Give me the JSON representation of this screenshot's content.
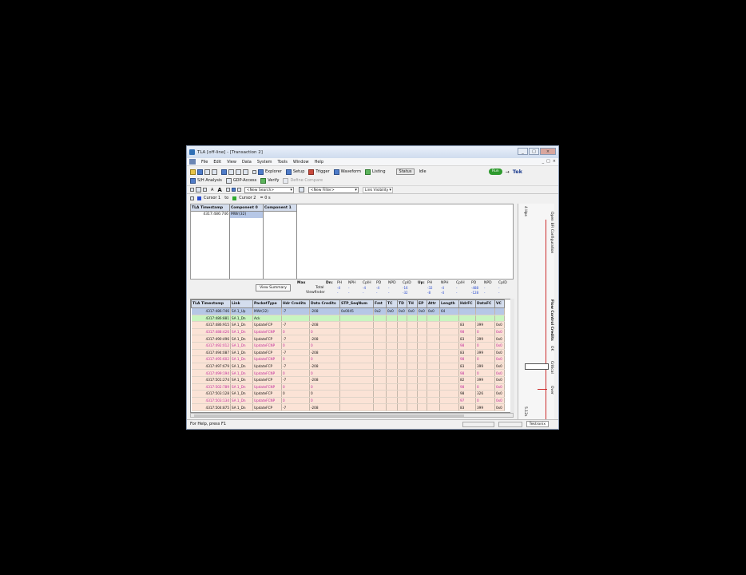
{
  "window": {
    "title": "TLA [off-line] - [Transaction 2]",
    "controls": {
      "minimize": "_",
      "maximize": "□",
      "close": "×"
    },
    "mdi_controls": [
      "_",
      "□",
      "×"
    ]
  },
  "menu": [
    "File",
    "Edit",
    "View",
    "Data",
    "System",
    "Tools",
    "Window",
    "Help"
  ],
  "toolbar1": {
    "explorer": "Explorer",
    "setup": "Setup",
    "trigger": "Trigger",
    "waveform": "Waveform",
    "listing": "Listing",
    "status": "Status",
    "state": "Idle",
    "run": "Run",
    "brand": "Tek"
  },
  "toolbar2": {
    "sh_analysis": "S/H Analysis",
    "gdp_access": "GDP-Access",
    "verify": "Verify",
    "define_compare": "Define Compare"
  },
  "toolbar3": {
    "font_a": "A",
    "font_a2": "A",
    "search_combo": "<New Search>",
    "filter_combo": "<New Filter>",
    "link_visibility": "Link Visibility"
  },
  "cursor_bar": {
    "cursor1": "Cursor 1",
    "to": "to",
    "cursor2": "Cursor 2",
    "delta": "= 0 s"
  },
  "top_table": {
    "headers": [
      "TLA Timestamp",
      "Component 0",
      "Component 1"
    ],
    "rows": [
      [
        "4317:486:746",
        "MWr(32)",
        ""
      ]
    ]
  },
  "summary": {
    "button": "View Summary",
    "max": "Max",
    "total": "Total",
    "viewfinder": "Viewfinder",
    "dn": "Dn:",
    "up": "Up:",
    "dn_cols": [
      "PH",
      "NPH",
      "CplH",
      "PD",
      "NPD",
      "CplD"
    ],
    "up_cols": [
      "PH",
      "NPH",
      "CplH",
      "PD",
      "NPD",
      "CplD"
    ],
    "dn_total": [
      "-4",
      "-",
      "-4",
      "-4",
      "-",
      "-16"
    ],
    "dn_view": [
      "-",
      "-",
      "-",
      "-",
      "-",
      "-32"
    ],
    "up_total": [
      "-32",
      "-4",
      "-",
      "-488",
      "-",
      "-"
    ],
    "up_view": [
      "-8",
      "-4",
      "-",
      "-128",
      "-",
      "-"
    ]
  },
  "main_table": {
    "headers": [
      "TLA Timestamp",
      "Link",
      "PacketType",
      "Hdr Credits",
      "Data Credits",
      "STP_SeqNum",
      "Fmt",
      "TC",
      "TD",
      "TH",
      "EP",
      "Attr",
      "Length",
      "HdrFC",
      "DataFC",
      "VC"
    ],
    "rows": [
      {
        "cls": "sel",
        "cells": [
          "4317:486:746",
          "SA 1_Up",
          "MWr(32)",
          "-7",
          "-208",
          "0x0045",
          "0x2",
          "0x0",
          "0x0",
          "0x0",
          "0x0",
          "0x0",
          "64",
          "",
          "",
          ""
        ]
      },
      {
        "cls": "ack",
        "cells": [
          "4317:486:881",
          "SA 1_Dn",
          "Ack",
          "",
          "",
          "",
          "",
          "",
          "",
          "",
          "",
          "",
          "",
          "",
          "",
          ""
        ]
      },
      {
        "cls": "fc",
        "cells": [
          "4317:486:915",
          "SA 1_Dn",
          "UpdateFCP",
          "-7",
          "-208",
          "",
          "",
          "",
          "",
          "",
          "",
          "",
          "",
          "83",
          "399",
          "0x0"
        ]
      },
      {
        "cls": "fc np",
        "cells": [
          "4317:488:426",
          "SA 1_Dn",
          "UpdateFCNP",
          "0",
          "0",
          "",
          "",
          "",
          "",
          "",
          "",
          "",
          "",
          "98",
          "0",
          "0x0"
        ]
      },
      {
        "cls": "fc",
        "cells": [
          "4317:490:496",
          "SA 1_Dn",
          "UpdateFCP",
          "-7",
          "-208",
          "",
          "",
          "",
          "",
          "",
          "",
          "",
          "",
          "83",
          "399",
          "0x0"
        ]
      },
      {
        "cls": "fc np",
        "cells": [
          "4317:492:012",
          "SA 1_Dn",
          "UpdateFCNP",
          "0",
          "0",
          "",
          "",
          "",
          "",
          "",
          "",
          "",
          "",
          "98",
          "0",
          "0x0"
        ]
      },
      {
        "cls": "fc",
        "cells": [
          "4317:494:087",
          "SA 1_Dn",
          "UpdateFCP",
          "-7",
          "-208",
          "",
          "",
          "",
          "",
          "",
          "",
          "",
          "",
          "83",
          "399",
          "0x0"
        ]
      },
      {
        "cls": "fc np",
        "cells": [
          "4317:495:602",
          "SA 1_Dn",
          "UpdateFCNP",
          "0",
          "0",
          "",
          "",
          "",
          "",
          "",
          "",
          "",
          "",
          "98",
          "0",
          "0x0"
        ]
      },
      {
        "cls": "fc",
        "cells": [
          "4317:497:679",
          "SA 1_Dn",
          "UpdateFCP",
          "-7",
          "-208",
          "",
          "",
          "",
          "",
          "",
          "",
          "",
          "",
          "83",
          "399",
          "0x0"
        ]
      },
      {
        "cls": "fc np",
        "cells": [
          "4317:499:194",
          "SA 1_Dn",
          "UpdateFCNP",
          "0",
          "0",
          "",
          "",
          "",
          "",
          "",
          "",
          "",
          "",
          "98",
          "0",
          "0x0"
        ]
      },
      {
        "cls": "fc",
        "cells": [
          "4317:501:274",
          "SA 1_Dn",
          "UpdateFCP",
          "-7",
          "-208",
          "",
          "",
          "",
          "",
          "",
          "",
          "",
          "",
          "82",
          "399",
          "0x0"
        ]
      },
      {
        "cls": "fc np",
        "cells": [
          "4317:502:789",
          "SA 1_Dn",
          "UpdateFCNP",
          "0",
          "0",
          "",
          "",
          "",
          "",
          "",
          "",
          "",
          "",
          "98",
          "0",
          "0x0"
        ]
      },
      {
        "cls": "fc",
        "cells": [
          "4317:503:128",
          "SA 1_Dn",
          "UpdateFCP",
          "0",
          "0",
          "",
          "",
          "",
          "",
          "",
          "",
          "",
          "",
          "98",
          "326",
          "0x0"
        ]
      },
      {
        "cls": "fc np",
        "cells": [
          "4317:503:134",
          "SA 1_Dn",
          "UpdateFCNP",
          "0",
          "0",
          "",
          "",
          "",
          "",
          "",
          "",
          "",
          "",
          "97",
          "0",
          "0x0"
        ]
      },
      {
        "cls": "fc",
        "cells": [
          "4317:504:875",
          "SA 1_Dn",
          "UpdateFCP",
          "-7",
          "-208",
          "",
          "",
          "",
          "",
          "",
          "",
          "",
          "",
          "83",
          "399",
          "0x0"
        ]
      }
    ]
  },
  "side_panel": {
    "top_label": "4 Hps",
    "config": "Open BFI Configuration",
    "flow_credits": "Flow Control Credits",
    "ok": "OK",
    "critical": "Critical",
    "over": "Over",
    "bottom_label": "5.12s"
  },
  "statusbar": {
    "help": "For Help, press F1",
    "brand": "Tektronix"
  }
}
